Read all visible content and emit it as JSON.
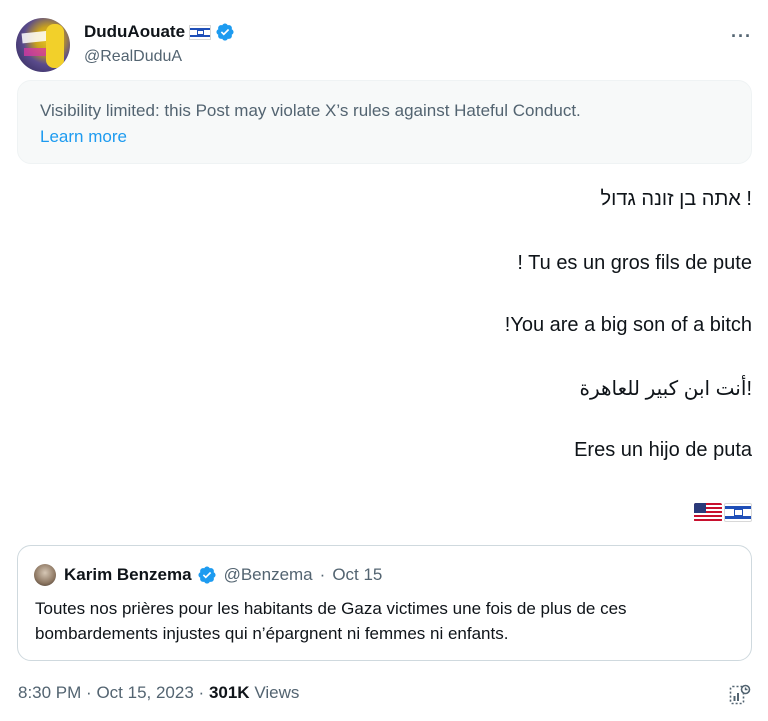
{
  "author": {
    "display_name": "DuduAouate",
    "handle": "@RealDuduA"
  },
  "icons": {
    "more": "more-horizontal-icon",
    "verified": "verified-badge-icon",
    "analytics": "analytics-icon"
  },
  "notice": {
    "text": "Visibility limited: this Post may violate X’s rules against Hateful Conduct.",
    "link": "Learn more"
  },
  "post": {
    "lines": [
      "אתה בן זונה גדול !",
      "! Tu es un gros fils de pute",
      "!You are a big son of a bitch",
      "أنت ابن كبير للعاهرة!",
      "Eres un hijo de puta"
    ]
  },
  "quote": {
    "name": "Karim Benzema",
    "handle": "@Benzema",
    "separator": "·",
    "date": "Oct 15",
    "text": "Toutes nos prières pour les habitants de Gaza victimes une fois de plus de ces bombardements injustes qui n’épargnent ni femmes ni enfants."
  },
  "footer": {
    "time": "8:30 PM",
    "sep1": "·",
    "date": "Oct 15, 2023",
    "sep2": "·",
    "views_count": "301K",
    "views_label": "Views"
  },
  "colors": {
    "accent": "#1d9bf0",
    "muted": "#536471",
    "text": "#0f1419"
  }
}
